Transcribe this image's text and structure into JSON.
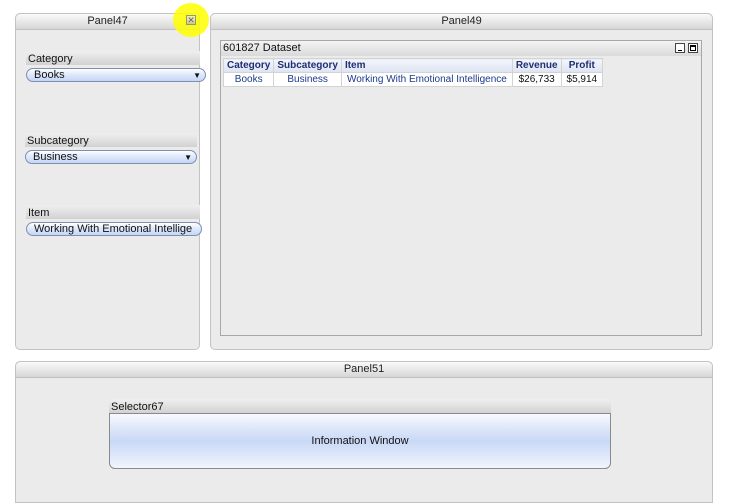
{
  "panel47": {
    "title": "Panel47",
    "close_glyph": "✕",
    "category": {
      "label": "Category",
      "value": "Books"
    },
    "subcategory": {
      "label": "Subcategory",
      "value": "Business"
    },
    "item": {
      "label": "Item",
      "value": "Working With Emotional Intellige"
    },
    "dropdown_glyph": "▼"
  },
  "panel49": {
    "title": "Panel49",
    "dataset": {
      "title": "601827 Dataset",
      "columns": [
        "Category",
        "Subcategory",
        "Item",
        "Revenue",
        "Profit"
      ],
      "rows": [
        [
          "Books",
          "Business",
          "Working With Emotional Intelligence",
          "$26,733",
          "$5,914"
        ]
      ]
    }
  },
  "panel51": {
    "title": "Panel51",
    "selector": {
      "label": "Selector67",
      "window_text": "Information Window"
    }
  },
  "colors": {
    "highlight": "#ffff00",
    "panel_bg": "#ebebeb",
    "header_text": "#1e2f74",
    "cell_text": "#1c3a8c"
  },
  "icons": [
    "close-icon",
    "dropdown-arrow-icon",
    "minimize-icon",
    "maximize-icon"
  ]
}
